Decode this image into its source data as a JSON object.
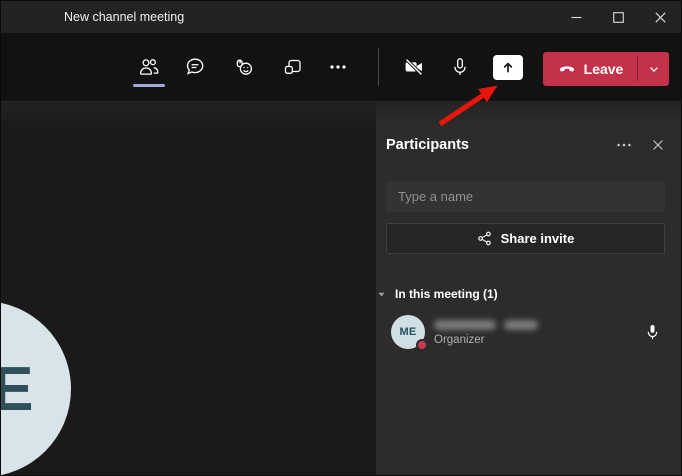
{
  "window": {
    "title": "New channel meeting",
    "controls": [
      "minimize-icon",
      "maximize-icon",
      "close-icon"
    ]
  },
  "toolbar": {
    "left_icons": [
      "participants-icon",
      "chat-icon",
      "reactions-icon",
      "breakout-rooms-icon",
      "more-icon"
    ],
    "active_tab": "participants",
    "right_icons": [
      "camera-off-icon",
      "microphone-icon",
      "share-screen-icon"
    ],
    "leave": {
      "label": "Leave"
    }
  },
  "annotation": {
    "type": "arrow",
    "color": "#e8150b",
    "points_to": "share-screen-button"
  },
  "stage": {
    "avatar_initials": "ME",
    "visible_letter": "E"
  },
  "panel": {
    "title": "Participants",
    "header_icons": [
      "more-options-icon",
      "close-icon"
    ],
    "search": {
      "placeholder": "Type a name"
    },
    "share_invite": {
      "label": "Share invite",
      "icon": "share-icon"
    },
    "section": {
      "label": "In this meeting (1)",
      "icon": "chevron-down-icon"
    },
    "participants": [
      {
        "initials": "ME",
        "name_blurred": true,
        "role": "Organizer",
        "status": "busy",
        "mic_icon": "microphone-icon"
      }
    ]
  },
  "colors": {
    "titlebar_bg": "#242323",
    "toolbar_bg": "#131212",
    "stage_bg": "#1b1a1a",
    "panel_bg": "#2d2c2c",
    "accent_underline": "#a6a7dc",
    "leave_button": "#c4314b",
    "arrow": "#e8150b",
    "avatar_bg": "#d8e4e7",
    "avatar_text": "#2f4f5b",
    "status_busy": "#cb3a4e"
  }
}
